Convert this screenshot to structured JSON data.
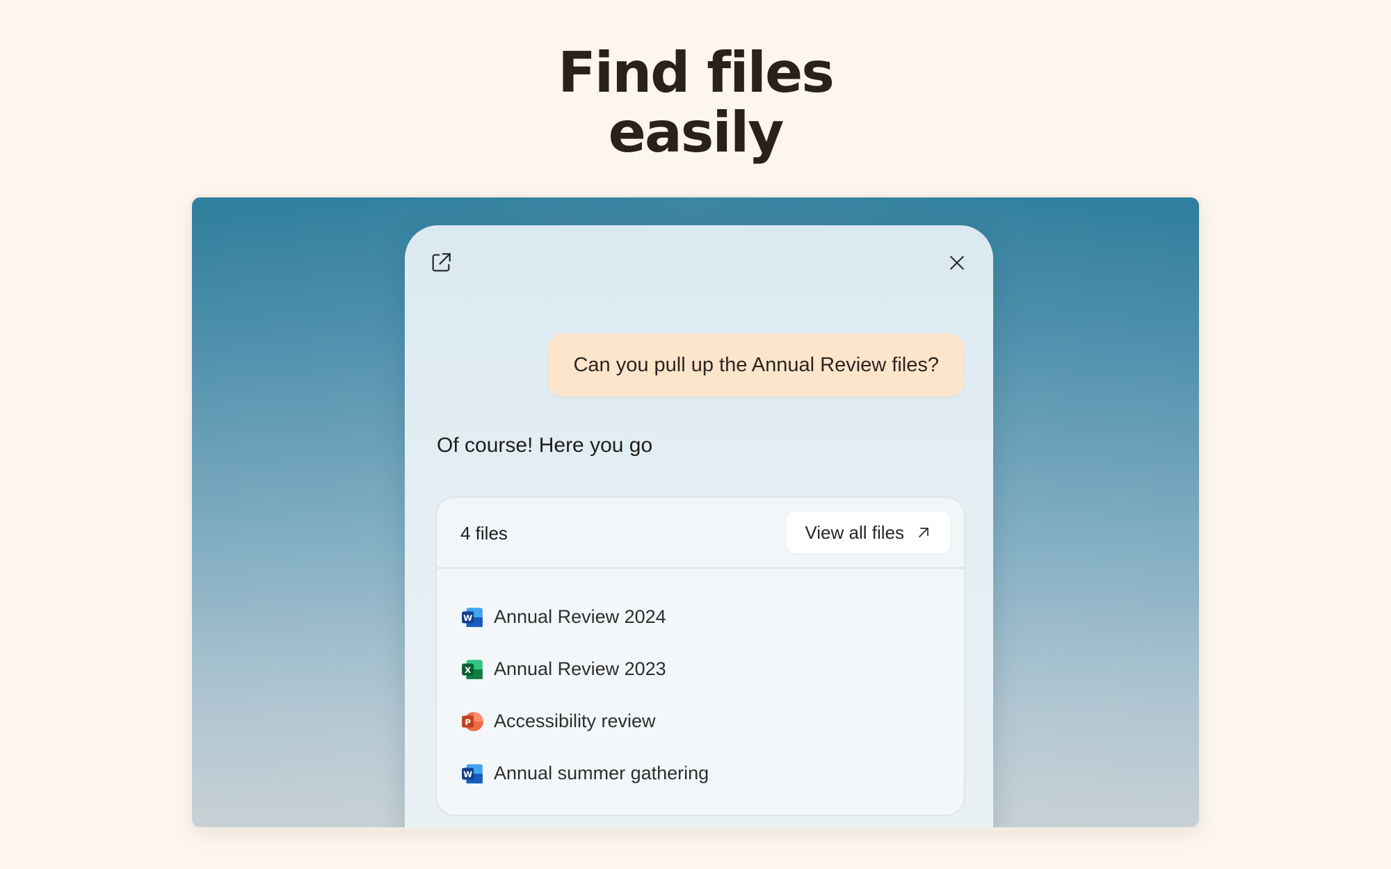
{
  "hero": {
    "line1": "Find files",
    "line2": "easily"
  },
  "chat": {
    "user_message": "Can you pull up the Annual Review files?",
    "assistant_message": "Of course! Here you go",
    "toolbar": {
      "popout_icon": "open-in-new-window-icon",
      "close_icon": "close-icon"
    }
  },
  "files": {
    "count_label": "4 files",
    "view_all_label": "View all files",
    "items": [
      {
        "name": "Annual Review 2024",
        "type": "word",
        "icon_letter": "W"
      },
      {
        "name": "Annual Review 2023",
        "type": "excel",
        "icon_letter": "X"
      },
      {
        "name": "Accessibility review",
        "type": "powerpoint",
        "icon_letter": "P"
      },
      {
        "name": "Annual summer gathering",
        "type": "word",
        "icon_letter": "W"
      }
    ]
  },
  "colors": {
    "page_bg": "#fdf6ee",
    "user_bubble": "#fde5cc",
    "word": "#185abd",
    "excel": "#107c41",
    "powerpoint": "#c43e1c"
  }
}
